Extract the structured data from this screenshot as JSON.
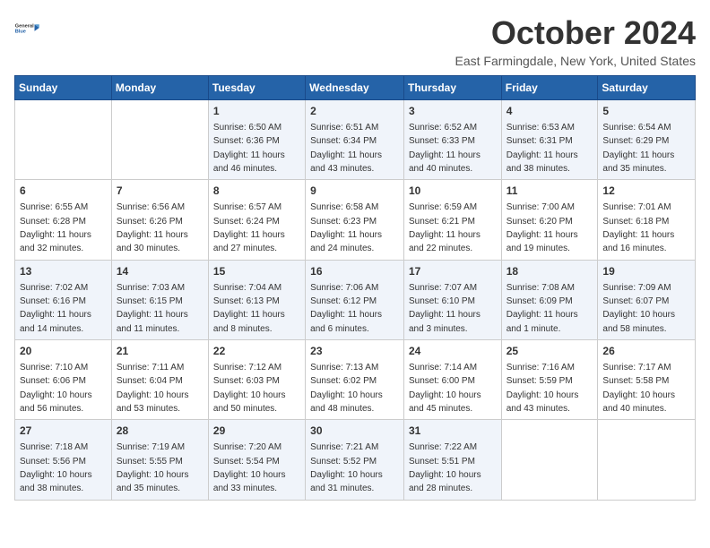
{
  "logo": {
    "line1": "General",
    "line2": "Blue"
  },
  "title": "October 2024",
  "location": "East Farmingdale, New York, United States",
  "weekdays": [
    "Sunday",
    "Monday",
    "Tuesday",
    "Wednesday",
    "Thursday",
    "Friday",
    "Saturday"
  ],
  "weeks": [
    [
      {
        "day": "",
        "sunrise": "",
        "sunset": "",
        "daylight": ""
      },
      {
        "day": "",
        "sunrise": "",
        "sunset": "",
        "daylight": ""
      },
      {
        "day": "1",
        "sunrise": "Sunrise: 6:50 AM",
        "sunset": "Sunset: 6:36 PM",
        "daylight": "Daylight: 11 hours and 46 minutes."
      },
      {
        "day": "2",
        "sunrise": "Sunrise: 6:51 AM",
        "sunset": "Sunset: 6:34 PM",
        "daylight": "Daylight: 11 hours and 43 minutes."
      },
      {
        "day": "3",
        "sunrise": "Sunrise: 6:52 AM",
        "sunset": "Sunset: 6:33 PM",
        "daylight": "Daylight: 11 hours and 40 minutes."
      },
      {
        "day": "4",
        "sunrise": "Sunrise: 6:53 AM",
        "sunset": "Sunset: 6:31 PM",
        "daylight": "Daylight: 11 hours and 38 minutes."
      },
      {
        "day": "5",
        "sunrise": "Sunrise: 6:54 AM",
        "sunset": "Sunset: 6:29 PM",
        "daylight": "Daylight: 11 hours and 35 minutes."
      }
    ],
    [
      {
        "day": "6",
        "sunrise": "Sunrise: 6:55 AM",
        "sunset": "Sunset: 6:28 PM",
        "daylight": "Daylight: 11 hours and 32 minutes."
      },
      {
        "day": "7",
        "sunrise": "Sunrise: 6:56 AM",
        "sunset": "Sunset: 6:26 PM",
        "daylight": "Daylight: 11 hours and 30 minutes."
      },
      {
        "day": "8",
        "sunrise": "Sunrise: 6:57 AM",
        "sunset": "Sunset: 6:24 PM",
        "daylight": "Daylight: 11 hours and 27 minutes."
      },
      {
        "day": "9",
        "sunrise": "Sunrise: 6:58 AM",
        "sunset": "Sunset: 6:23 PM",
        "daylight": "Daylight: 11 hours and 24 minutes."
      },
      {
        "day": "10",
        "sunrise": "Sunrise: 6:59 AM",
        "sunset": "Sunset: 6:21 PM",
        "daylight": "Daylight: 11 hours and 22 minutes."
      },
      {
        "day": "11",
        "sunrise": "Sunrise: 7:00 AM",
        "sunset": "Sunset: 6:20 PM",
        "daylight": "Daylight: 11 hours and 19 minutes."
      },
      {
        "day": "12",
        "sunrise": "Sunrise: 7:01 AM",
        "sunset": "Sunset: 6:18 PM",
        "daylight": "Daylight: 11 hours and 16 minutes."
      }
    ],
    [
      {
        "day": "13",
        "sunrise": "Sunrise: 7:02 AM",
        "sunset": "Sunset: 6:16 PM",
        "daylight": "Daylight: 11 hours and 14 minutes."
      },
      {
        "day": "14",
        "sunrise": "Sunrise: 7:03 AM",
        "sunset": "Sunset: 6:15 PM",
        "daylight": "Daylight: 11 hours and 11 minutes."
      },
      {
        "day": "15",
        "sunrise": "Sunrise: 7:04 AM",
        "sunset": "Sunset: 6:13 PM",
        "daylight": "Daylight: 11 hours and 8 minutes."
      },
      {
        "day": "16",
        "sunrise": "Sunrise: 7:06 AM",
        "sunset": "Sunset: 6:12 PM",
        "daylight": "Daylight: 11 hours and 6 minutes."
      },
      {
        "day": "17",
        "sunrise": "Sunrise: 7:07 AM",
        "sunset": "Sunset: 6:10 PM",
        "daylight": "Daylight: 11 hours and 3 minutes."
      },
      {
        "day": "18",
        "sunrise": "Sunrise: 7:08 AM",
        "sunset": "Sunset: 6:09 PM",
        "daylight": "Daylight: 11 hours and 1 minute."
      },
      {
        "day": "19",
        "sunrise": "Sunrise: 7:09 AM",
        "sunset": "Sunset: 6:07 PM",
        "daylight": "Daylight: 10 hours and 58 minutes."
      }
    ],
    [
      {
        "day": "20",
        "sunrise": "Sunrise: 7:10 AM",
        "sunset": "Sunset: 6:06 PM",
        "daylight": "Daylight: 10 hours and 56 minutes."
      },
      {
        "day": "21",
        "sunrise": "Sunrise: 7:11 AM",
        "sunset": "Sunset: 6:04 PM",
        "daylight": "Daylight: 10 hours and 53 minutes."
      },
      {
        "day": "22",
        "sunrise": "Sunrise: 7:12 AM",
        "sunset": "Sunset: 6:03 PM",
        "daylight": "Daylight: 10 hours and 50 minutes."
      },
      {
        "day": "23",
        "sunrise": "Sunrise: 7:13 AM",
        "sunset": "Sunset: 6:02 PM",
        "daylight": "Daylight: 10 hours and 48 minutes."
      },
      {
        "day": "24",
        "sunrise": "Sunrise: 7:14 AM",
        "sunset": "Sunset: 6:00 PM",
        "daylight": "Daylight: 10 hours and 45 minutes."
      },
      {
        "day": "25",
        "sunrise": "Sunrise: 7:16 AM",
        "sunset": "Sunset: 5:59 PM",
        "daylight": "Daylight: 10 hours and 43 minutes."
      },
      {
        "day": "26",
        "sunrise": "Sunrise: 7:17 AM",
        "sunset": "Sunset: 5:58 PM",
        "daylight": "Daylight: 10 hours and 40 minutes."
      }
    ],
    [
      {
        "day": "27",
        "sunrise": "Sunrise: 7:18 AM",
        "sunset": "Sunset: 5:56 PM",
        "daylight": "Daylight: 10 hours and 38 minutes."
      },
      {
        "day": "28",
        "sunrise": "Sunrise: 7:19 AM",
        "sunset": "Sunset: 5:55 PM",
        "daylight": "Daylight: 10 hours and 35 minutes."
      },
      {
        "day": "29",
        "sunrise": "Sunrise: 7:20 AM",
        "sunset": "Sunset: 5:54 PM",
        "daylight": "Daylight: 10 hours and 33 minutes."
      },
      {
        "day": "30",
        "sunrise": "Sunrise: 7:21 AM",
        "sunset": "Sunset: 5:52 PM",
        "daylight": "Daylight: 10 hours and 31 minutes."
      },
      {
        "day": "31",
        "sunrise": "Sunrise: 7:22 AM",
        "sunset": "Sunset: 5:51 PM",
        "daylight": "Daylight: 10 hours and 28 minutes."
      },
      {
        "day": "",
        "sunrise": "",
        "sunset": "",
        "daylight": ""
      },
      {
        "day": "",
        "sunrise": "",
        "sunset": "",
        "daylight": ""
      }
    ]
  ]
}
